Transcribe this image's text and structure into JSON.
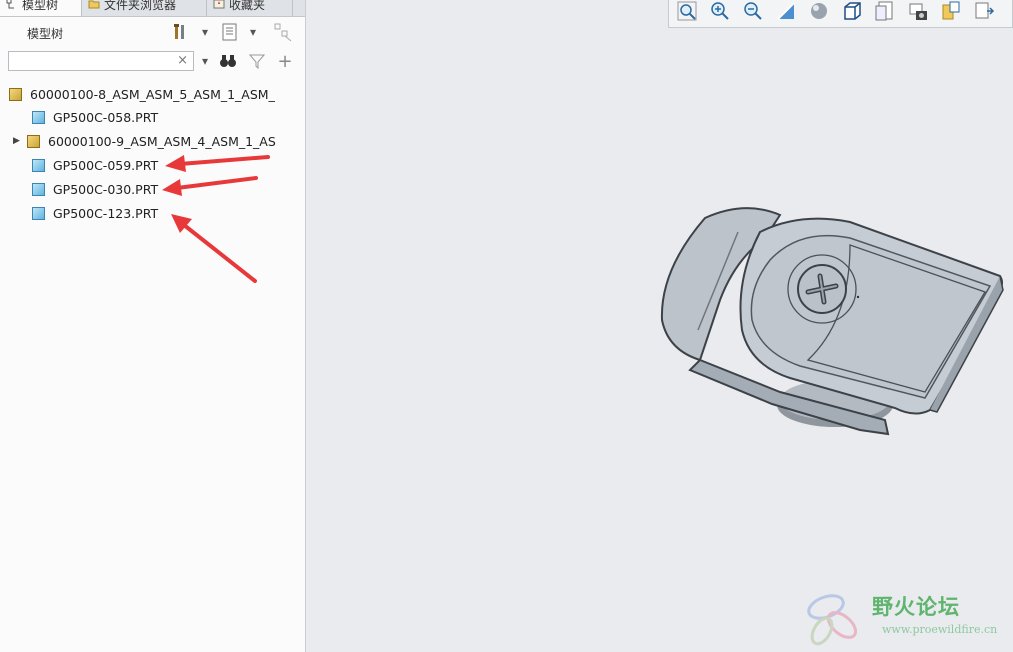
{
  "tabs": [
    {
      "label": "模型树",
      "icon": "model-tree-icon",
      "active": true
    },
    {
      "label": "文件夹浏览器",
      "icon": "folder-icon",
      "active": false
    },
    {
      "label": "收藏夹",
      "icon": "favorites-icon",
      "active": false
    }
  ],
  "model_tree": {
    "title": "模型树",
    "search": {
      "value": "",
      "placeholder": "",
      "clear_glyph": "×"
    },
    "items": [
      {
        "label": "60000100-8_ASM_ASM_5_ASM_1_ASM_",
        "type": "assembly",
        "expandable": false
      },
      {
        "label": "GP500C-058.PRT",
        "type": "part",
        "expandable": false
      },
      {
        "label": "60000100-9_ASM_ASM_4_ASM_1_AS",
        "type": "assembly",
        "expandable": true
      },
      {
        "label": "GP500C-059.PRT",
        "type": "part",
        "expandable": false
      },
      {
        "label": "GP500C-030.PRT",
        "type": "part",
        "expandable": false
      },
      {
        "label": "GP500C-123.PRT",
        "type": "part",
        "expandable": false
      }
    ]
  },
  "toolbar_icons": [
    "zoom-fit-icon",
    "zoom-in-icon",
    "zoom-out-icon",
    "reorient-icon",
    "display-style-icon",
    "saved-views-icon",
    "view-manager-icon",
    "snapshot-icon",
    "section-icon",
    "more-icon"
  ],
  "watermark": {
    "title": "野火论坛",
    "url": "www.proewildfire.cn"
  },
  "colors": {
    "annotation_arrow": "#e8393a",
    "accent_green": "#5fb56d"
  }
}
